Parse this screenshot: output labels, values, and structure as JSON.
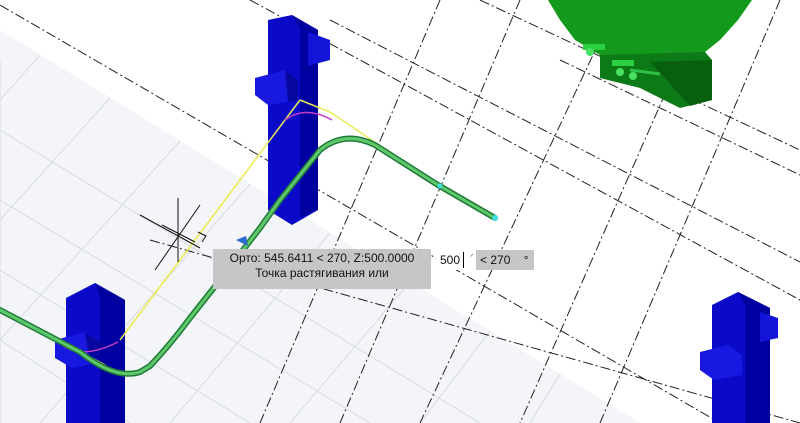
{
  "tooltip": {
    "line1": "Орто: 545.6411 < 270, Z:500.0000",
    "line2": "Точка растягивания или"
  },
  "input": {
    "distance_value": "500",
    "angle_prefix": "< 270",
    "degree_symbol": "°"
  },
  "colors": {
    "grid_fill": "#f2f4f7",
    "column_blue": "#0a0ac8",
    "tank_green": "#0c9a1c",
    "pipe_green": "#32a848",
    "guide_yellow": "#f0f064",
    "guide_magenta": "#c83cc8",
    "tooltip_bg": "#c6c6c6"
  }
}
